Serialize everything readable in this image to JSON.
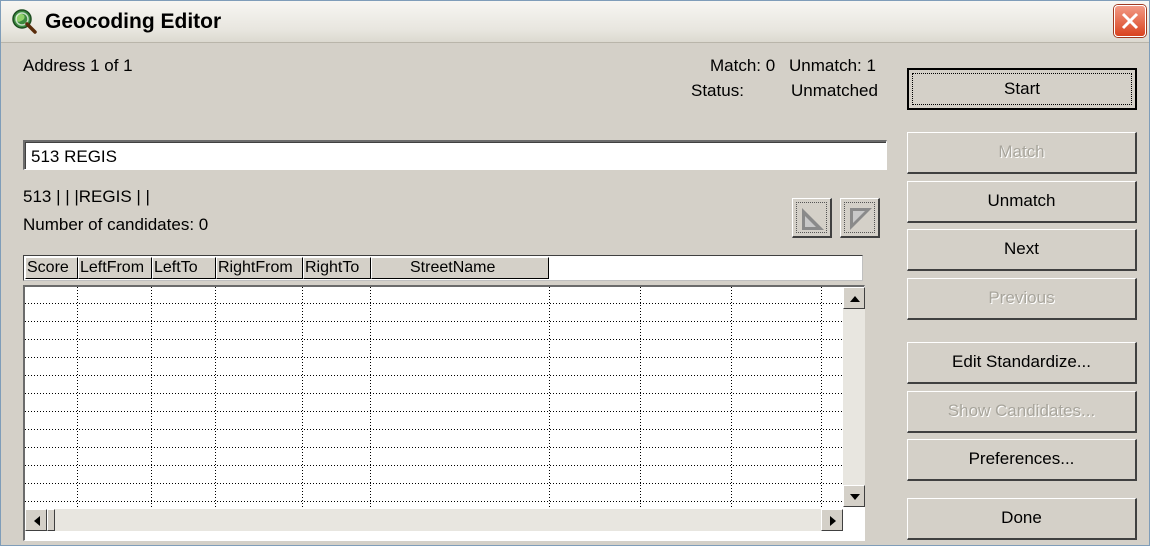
{
  "window": {
    "title": "Geocoding Editor"
  },
  "status": {
    "address_label": "Address 1 of 1",
    "match_label": "Match: 0",
    "unmatch_label": "Unmatch: 1",
    "status_label": "Status:",
    "status_value": "Unmatched"
  },
  "address_input": {
    "value": "513 REGIS"
  },
  "parsed": {
    "standardized": "513 |  |  |REGIS |  |",
    "candidates_text": "Number of candidates: 0"
  },
  "grid": {
    "columns": [
      "Score",
      "LeftFrom",
      "LeftTo",
      "RightFrom",
      "RightTo",
      "StreetName"
    ],
    "rows": []
  },
  "icons": {
    "app": "geocoding-globe-icon",
    "close": "close-icon",
    "tool1": "triangle-bottom-left-icon",
    "tool2": "triangle-top-right-icon"
  },
  "buttons": {
    "start": "Start",
    "match": "Match",
    "unmatch": "Unmatch",
    "next": "Next",
    "previous": "Previous",
    "edit_standardize": "Edit Standardize...",
    "show_candidates": "Show Candidates...",
    "preferences": "Preferences...",
    "done": "Done"
  },
  "colors": {
    "window_bg": "#d4d0c8",
    "close_button": "#d9431f",
    "disabled_text": "#a8a59c"
  }
}
